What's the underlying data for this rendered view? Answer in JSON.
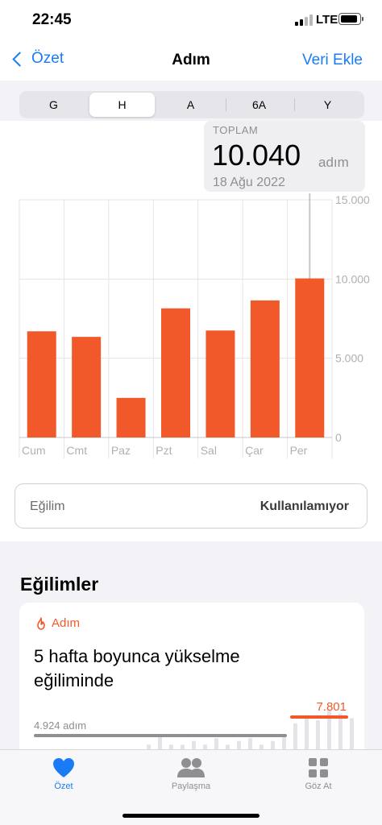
{
  "status_bar": {
    "time": "22:45",
    "network": "LTE"
  },
  "nav": {
    "back_label": "Özet",
    "title": "Adım",
    "action_label": "Veri Ekle"
  },
  "range_tabs": [
    {
      "label": "G",
      "selected": false
    },
    {
      "label": "H",
      "selected": true
    },
    {
      "label": "A",
      "selected": false
    },
    {
      "label": "6A",
      "selected": false
    },
    {
      "label": "Y",
      "selected": false
    }
  ],
  "callout": {
    "label": "TOPLAM",
    "value": "10.040",
    "unit": "adım",
    "date": "18 Ağu 2022"
  },
  "chart_data": {
    "type": "bar",
    "categories": [
      "Cum",
      "Cmt",
      "Paz",
      "Pzt",
      "Sal",
      "Çar",
      "Per"
    ],
    "values": [
      6700,
      6350,
      2500,
      8150,
      6750,
      8650,
      10040
    ],
    "ylim": [
      0,
      15000
    ],
    "y_ticks": [
      0,
      5000,
      10000,
      15000
    ],
    "y_tick_labels": [
      "0",
      "5.000",
      "10.000",
      "15.000"
    ],
    "bar_color": "#f2592a",
    "grid": true,
    "highlighted_category": "Per"
  },
  "trend_row": {
    "label": "Eğilim",
    "value": "Kullanılamıyor"
  },
  "trends_section": {
    "title": "Eğilimler",
    "card": {
      "category": "Adım",
      "category_icon": "flame-icon",
      "headline": "5 hafta boyunca yükselme eğiliminde",
      "previous_avg": 4924,
      "previous_label": "4.924 adım",
      "current_value": "7.801",
      "current_avg": 7801,
      "mini_bars": [
        0.3,
        0.46,
        0.3,
        0.3,
        0.37,
        0.3,
        0.42,
        0.3,
        0.37,
        0.42,
        0.3,
        0.37,
        0.46,
        0.7,
        0.84,
        0.76,
        0.94,
        0.88,
        0.8
      ]
    }
  },
  "tab_bar": [
    {
      "label": "Özet",
      "icon": "heart-icon",
      "active": true
    },
    {
      "label": "Paylaşma",
      "icon": "people-icon",
      "active": false
    },
    {
      "label": "Göz At",
      "icon": "grid-icon",
      "active": false
    }
  ],
  "colors": {
    "accent": "#1a7cf5",
    "steps": "#f2592a"
  }
}
